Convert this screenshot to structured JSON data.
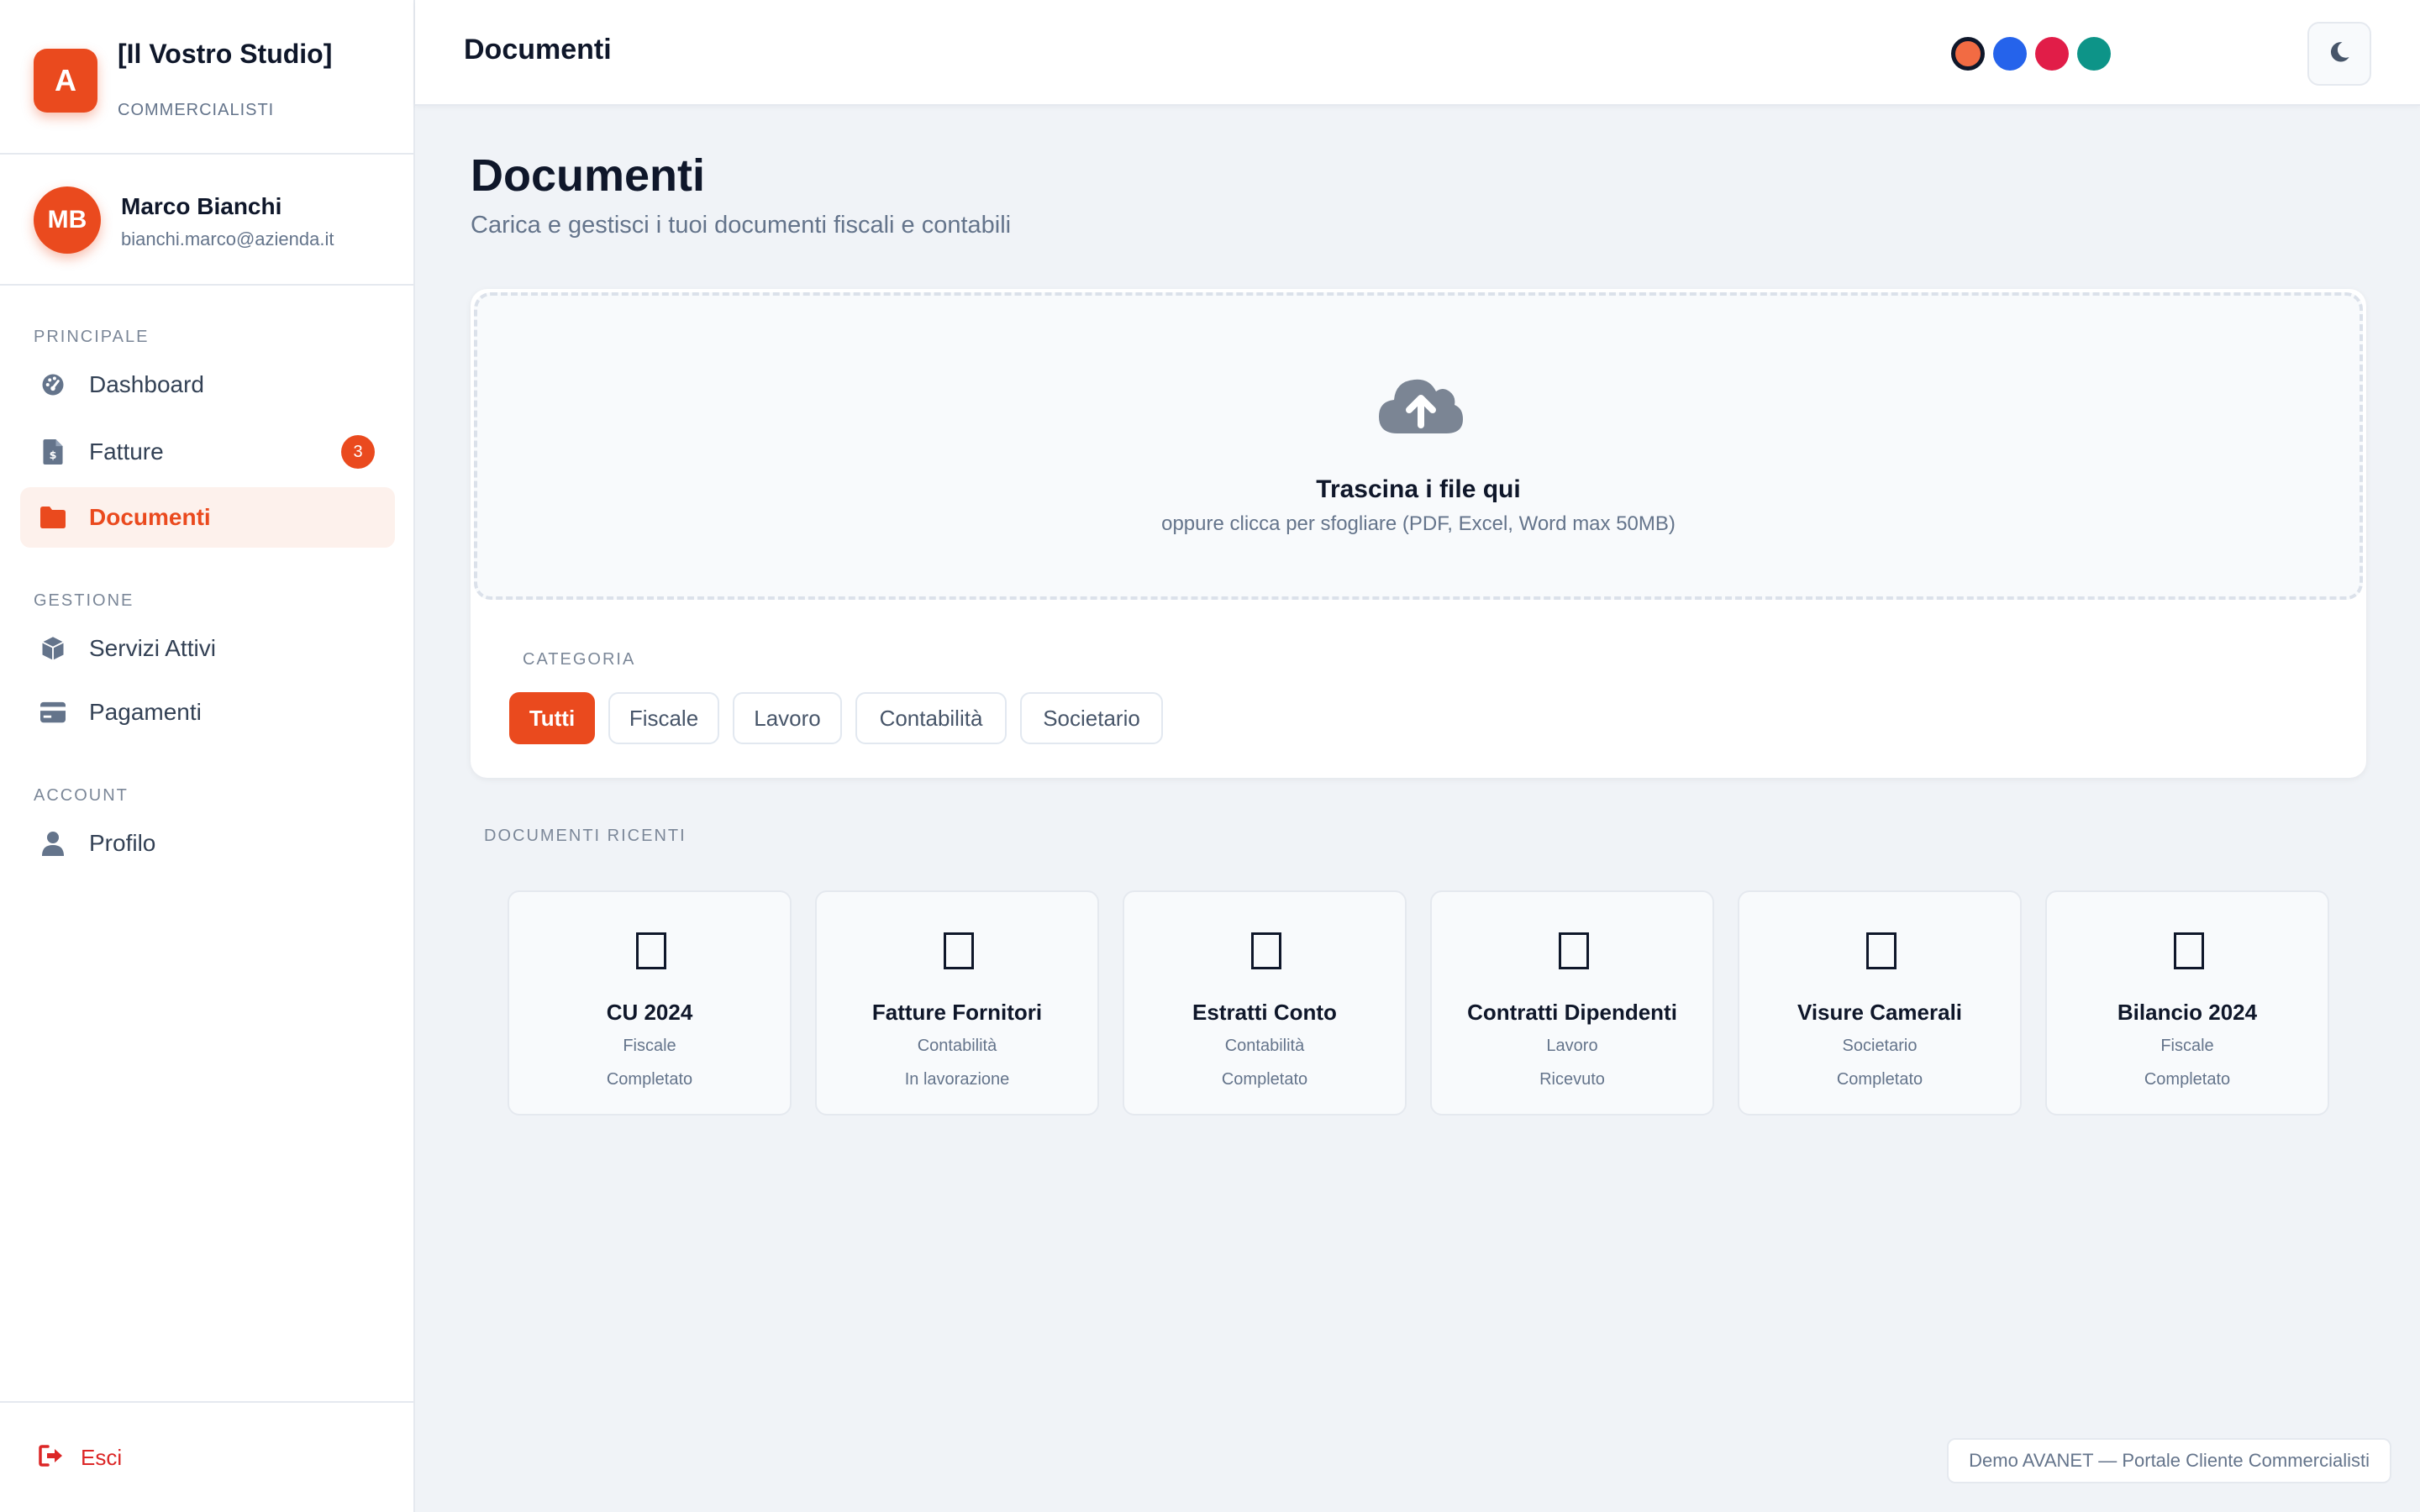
{
  "brand": {
    "logo_letter": "A",
    "name": "[Il Vostro Studio]",
    "subtitle": "COMMERCIALISTI"
  },
  "user": {
    "initials": "MB",
    "name": "Marco Bianchi",
    "email": "bianchi.marco@azienda.it"
  },
  "nav": {
    "sections": [
      {
        "label": "PRINCIPALE",
        "items": [
          {
            "label": "Dashboard",
            "icon": "dashboard-icon"
          },
          {
            "label": "Fatture",
            "icon": "invoice-icon",
            "badge": "3"
          },
          {
            "label": "Documenti",
            "icon": "folder-icon",
            "active": true
          }
        ]
      },
      {
        "label": "GESTIONE",
        "items": [
          {
            "label": "Servizi Attivi",
            "icon": "box-icon"
          },
          {
            "label": "Pagamenti",
            "icon": "credit-card-icon"
          }
        ]
      },
      {
        "label": "ACCOUNT",
        "items": [
          {
            "label": "Profilo",
            "icon": "user-icon"
          }
        ]
      }
    ],
    "logout_label": "Esci"
  },
  "header": {
    "title": "Documenti",
    "color_swatches": [
      "#f26b43",
      "#2563eb",
      "#e11d48",
      "#0d9488"
    ],
    "theme_icon": "moon-icon"
  },
  "main": {
    "title": "Documenti",
    "subtitle": "Carica e gestisci i tuoi documenti fiscali e contabili",
    "upload": {
      "icon": "cloud-upload-icon",
      "title": "Trascina i file qui",
      "hint": "oppure clicca per sfogliare (PDF, Excel, Word max 50MB)"
    },
    "category_label": "CATEGORIA",
    "categories": [
      "Tutti",
      "Fiscale",
      "Lavoro",
      "Contabilità",
      "Societario"
    ],
    "recent_label": "DOCUMENTI RICENTI",
    "documents": [
      {
        "name": "CU 2024",
        "category": "Fiscale",
        "status": "Completato"
      },
      {
        "name": "Fatture Fornitori",
        "category": "Contabilità",
        "status": "In lavorazione"
      },
      {
        "name": "Estratti Conto",
        "category": "Contabilità",
        "status": "Completato"
      },
      {
        "name": "Contratti Dipendenti",
        "category": "Lavoro",
        "status": "Ricevuto"
      },
      {
        "name": "Visure Camerali",
        "category": "Societario",
        "status": "Completato"
      },
      {
        "name": "Bilancio 2024",
        "category": "Fiscale",
        "status": "Completato"
      }
    ]
  },
  "colors": {
    "accent": "#ea4a1e",
    "danger": "#dc2626",
    "text": "#0f172a",
    "muted": "#64748b",
    "background": "#f0f3f7"
  },
  "footer_note": "Demo AVANET — Portale Cliente Commercialisti"
}
